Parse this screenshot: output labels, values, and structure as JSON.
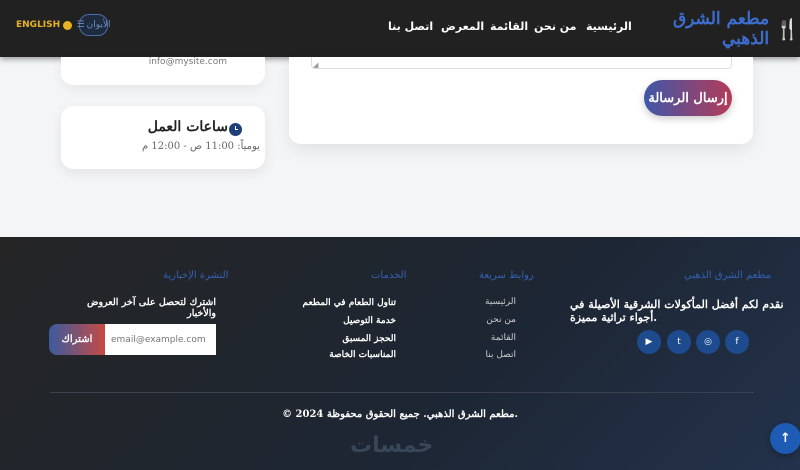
{
  "navbar": {
    "brand": "مطعم الشرق الذهبي",
    "brand_icon": "🍴",
    "links": [
      "الرئيسية",
      "من نحن",
      "القائمة",
      "المعرض",
      "اتصل بنا"
    ],
    "language": "ENGLISH",
    "menu_label": "الأيوان"
  },
  "contact": {
    "email": "info@mysite.com"
  },
  "hours": {
    "title": "ساعات العمل",
    "text": "يومياً: 11:00 ص - 12:00 م"
  },
  "form": {
    "send_label": "إرسال الرسالة"
  },
  "footer": {
    "about": {
      "heading": "مطعم الشرق الذهبي",
      "text": "نقدم لكم أفضل المأكولات الشرقية الأصيلة في أجواء تراثية مميزة."
    },
    "quick_links": {
      "heading": "روابط سريعة",
      "items": [
        "الرئيسية",
        "من نحن",
        "القائمة",
        "اتصل بنا"
      ]
    },
    "services": {
      "heading": "الخدمات",
      "items": [
        "تناول الطعام في المطعم",
        "خدمة التوصيل",
        "الحجز المسبق",
        "المناسبات الخاصة"
      ]
    },
    "newsletter": {
      "heading": "النشرة الإخبارية",
      "text": "اشترك لتحصل على آخر العروض والأخبار",
      "placeholder": "email@example.com",
      "button": "اشتراك"
    },
    "copyright": "© 2024 مطعم الشرق الذهبي. جميع الحقوق محفوظة.",
    "watermark": "خمسات"
  },
  "colors": {
    "navbar_bg": "#212121",
    "brand": "#3b6ecf",
    "accent_red": "#e8473b",
    "language": "#e8b323"
  }
}
